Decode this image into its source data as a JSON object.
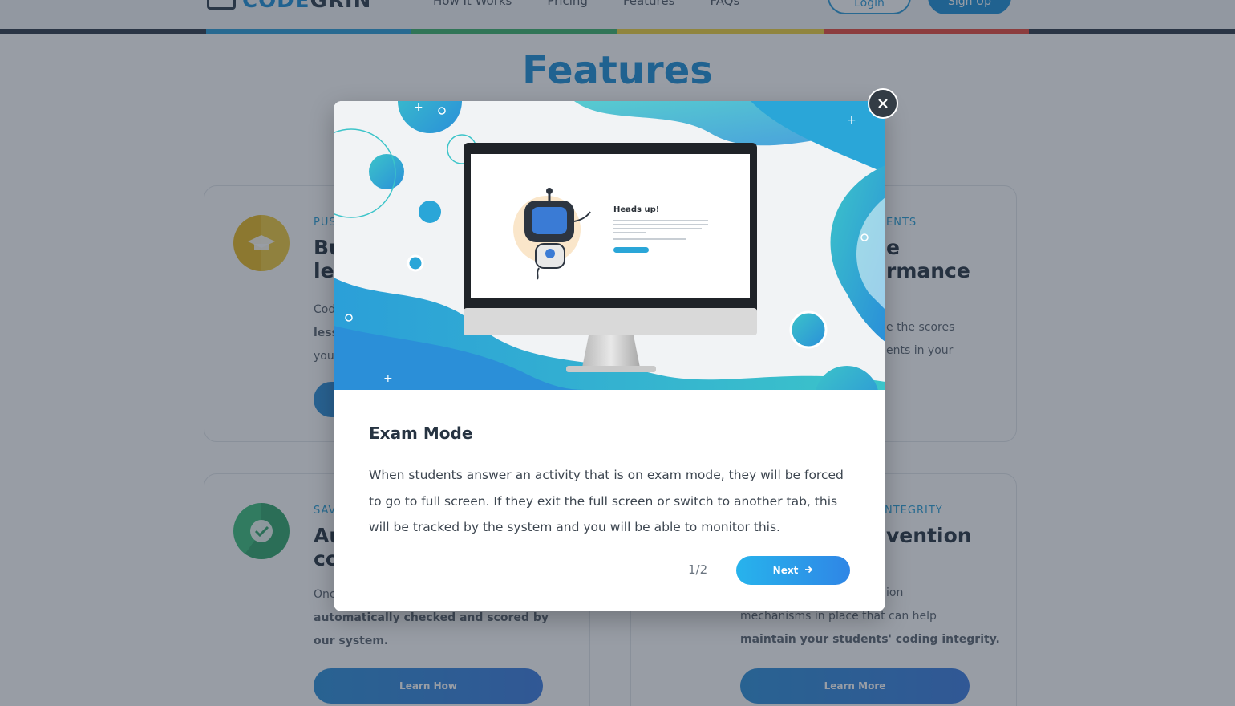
{
  "nav": {
    "logo_code": "CODE",
    "logo_grin": "GRIN",
    "links": [
      "How It Works",
      "Pricing",
      "Features",
      "FAQs"
    ],
    "login": "Login",
    "signup": "Sign Up"
  },
  "stripe_colors": [
    "#2c3947",
    "#2a9ed9",
    "#3bb26a",
    "#f0d23a",
    "#e8483a",
    "#2c3947"
  ],
  "page": {
    "features_title": "Features"
  },
  "cards": [
    {
      "label": "PUS",
      "heading_line1": "Bu",
      "heading_line2": "les",
      "desc_line1": "Cod",
      "desc_line2": "less",
      "desc_line3": "you"
    },
    {
      "label": "ENTS",
      "heading_line1": "e",
      "heading_line2": "rmance",
      "desc_line1": "e the scores",
      "desc_line2": "ents in your"
    },
    {
      "label": "SAV",
      "heading_line1": "Au",
      "heading_line2": "co",
      "desc_line1": "Onc",
      "desc_line2": "automatically checked and scored by",
      "desc_line3": "our system.",
      "cta": "Learn How"
    },
    {
      "label": "NTEGRITY",
      "heading_line1": "vention",
      "desc_line1": "ion",
      "desc_line2": "mechanisms in place that can help",
      "desc_line3": "maintain your students' coding integrity.",
      "cta": "Learn More"
    }
  ],
  "modal": {
    "screen_heading": "Heads up!",
    "title": "Exam Mode",
    "body": "When students answer an activity that is on exam mode, they will be forced to go to full screen. If they exit the full screen or switch to another tab, this will be tracked by the system and you will be able to monitor this.",
    "pager": "1/2",
    "next_label": "Next",
    "next_icon": "arrow-right-icon",
    "close_icon": "close-icon"
  },
  "colors": {
    "accent": "#1a8fd6",
    "teal": "#3cc4c9",
    "overlay": "rgba(40,50,66,0.48)"
  }
}
